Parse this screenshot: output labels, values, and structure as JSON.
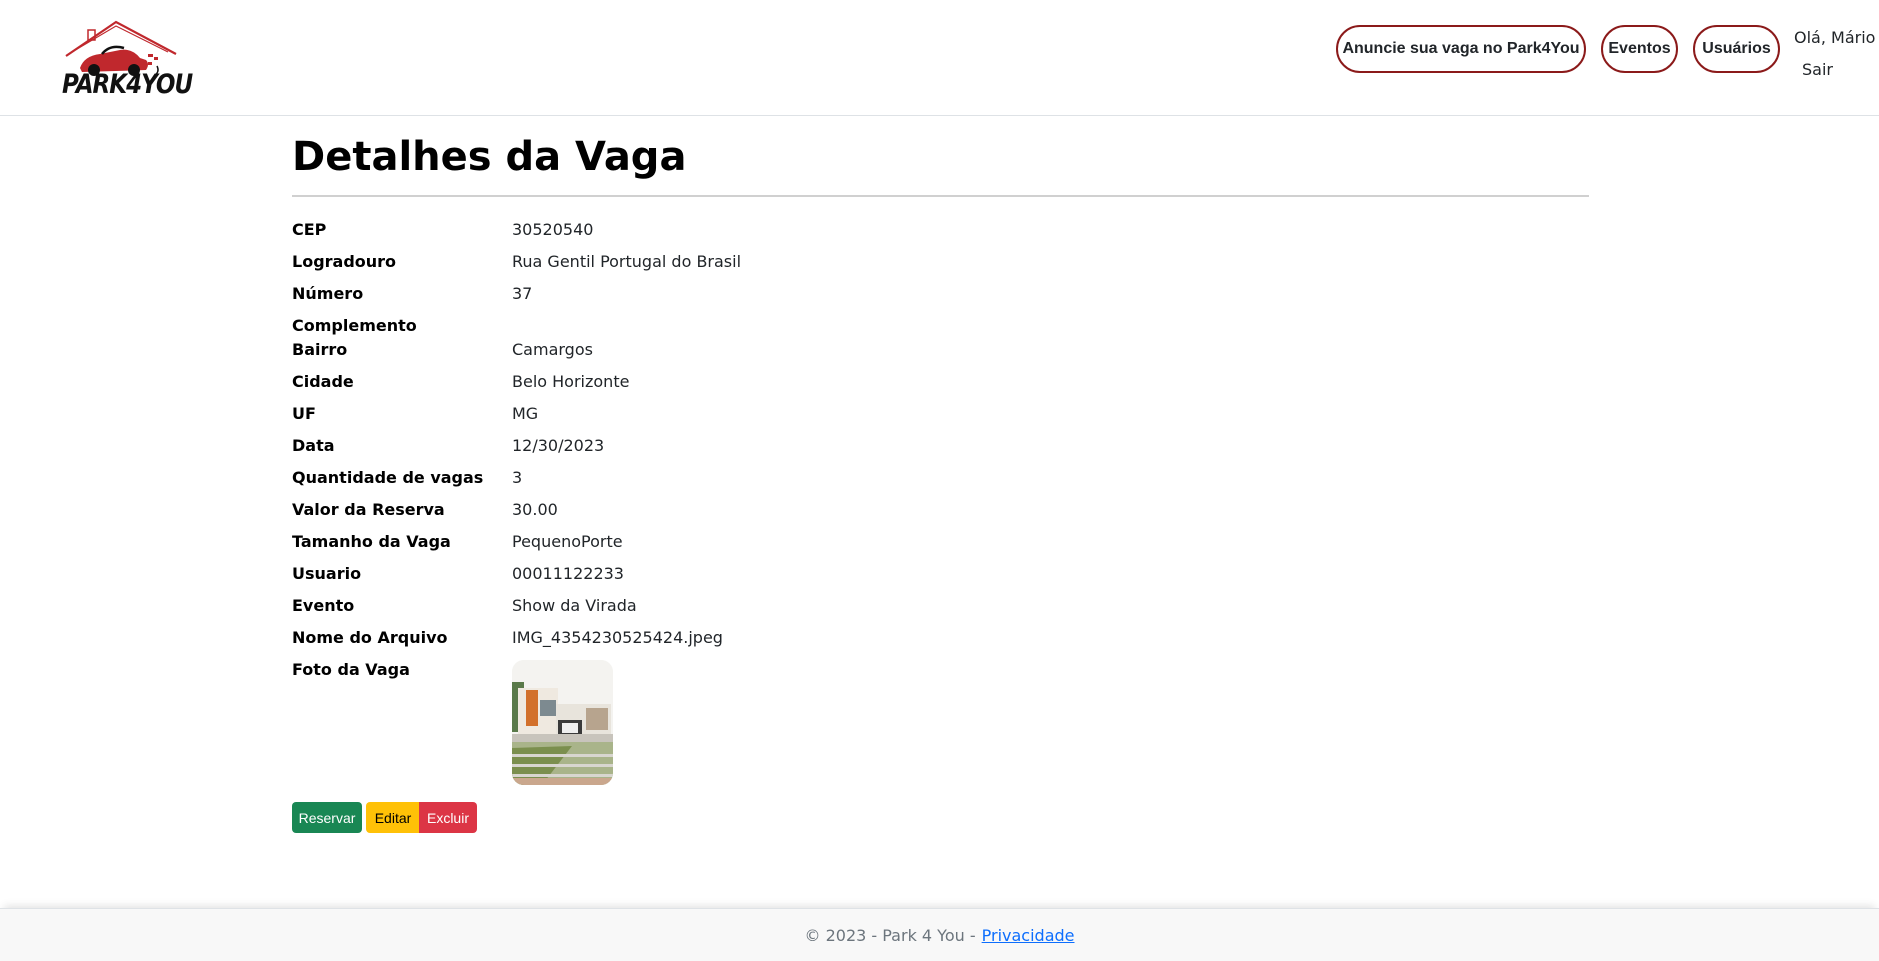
{
  "brand": {
    "name": "PARK4YOU",
    "accent": "#8b1a1a",
    "logo_red": "#c0282d"
  },
  "nav": {
    "advertise_label": "Anuncie sua vaga no Park4You",
    "events_label": "Eventos",
    "users_label": "Usuários",
    "greeting": "Olá, Mário",
    "logout_label": "Sair"
  },
  "page": {
    "title": "Detalhes da Vaga"
  },
  "details": [
    {
      "label": "CEP",
      "value": "30520540"
    },
    {
      "label": "Logradouro",
      "value": "Rua Gentil Portugal do Brasil"
    },
    {
      "label": "Número",
      "value": "37"
    },
    {
      "label": "Complemento",
      "value": ""
    },
    {
      "label": "Bairro",
      "value": "Camargos"
    },
    {
      "label": "Cidade",
      "value": "Belo Horizonte"
    },
    {
      "label": "UF",
      "value": "MG"
    },
    {
      "label": "Data",
      "value": "12/30/2023"
    },
    {
      "label": "Quantidade de vagas",
      "value": "3"
    },
    {
      "label": "Valor da Reserva",
      "value": "30.00"
    },
    {
      "label": "Tamanho da Vaga",
      "value": "PequenoPorte"
    },
    {
      "label": "Usuario",
      "value": "00011122233"
    },
    {
      "label": "Evento",
      "value": "Show da Virada"
    },
    {
      "label": "Nome do Arquivo",
      "value": "IMG_4354230525424.jpeg"
    },
    {
      "label": "Foto da Vaga",
      "value": ""
    }
  ],
  "actions": {
    "reserve_label": "Reservar",
    "edit_label": "Editar",
    "delete_label": "Excluir",
    "reserve_color": "#198754",
    "edit_color": "#ffc107",
    "delete_color": "#dc3545"
  },
  "footer": {
    "text": "© 2023 - Park 4 You -",
    "privacy_label": "Privacidade"
  }
}
